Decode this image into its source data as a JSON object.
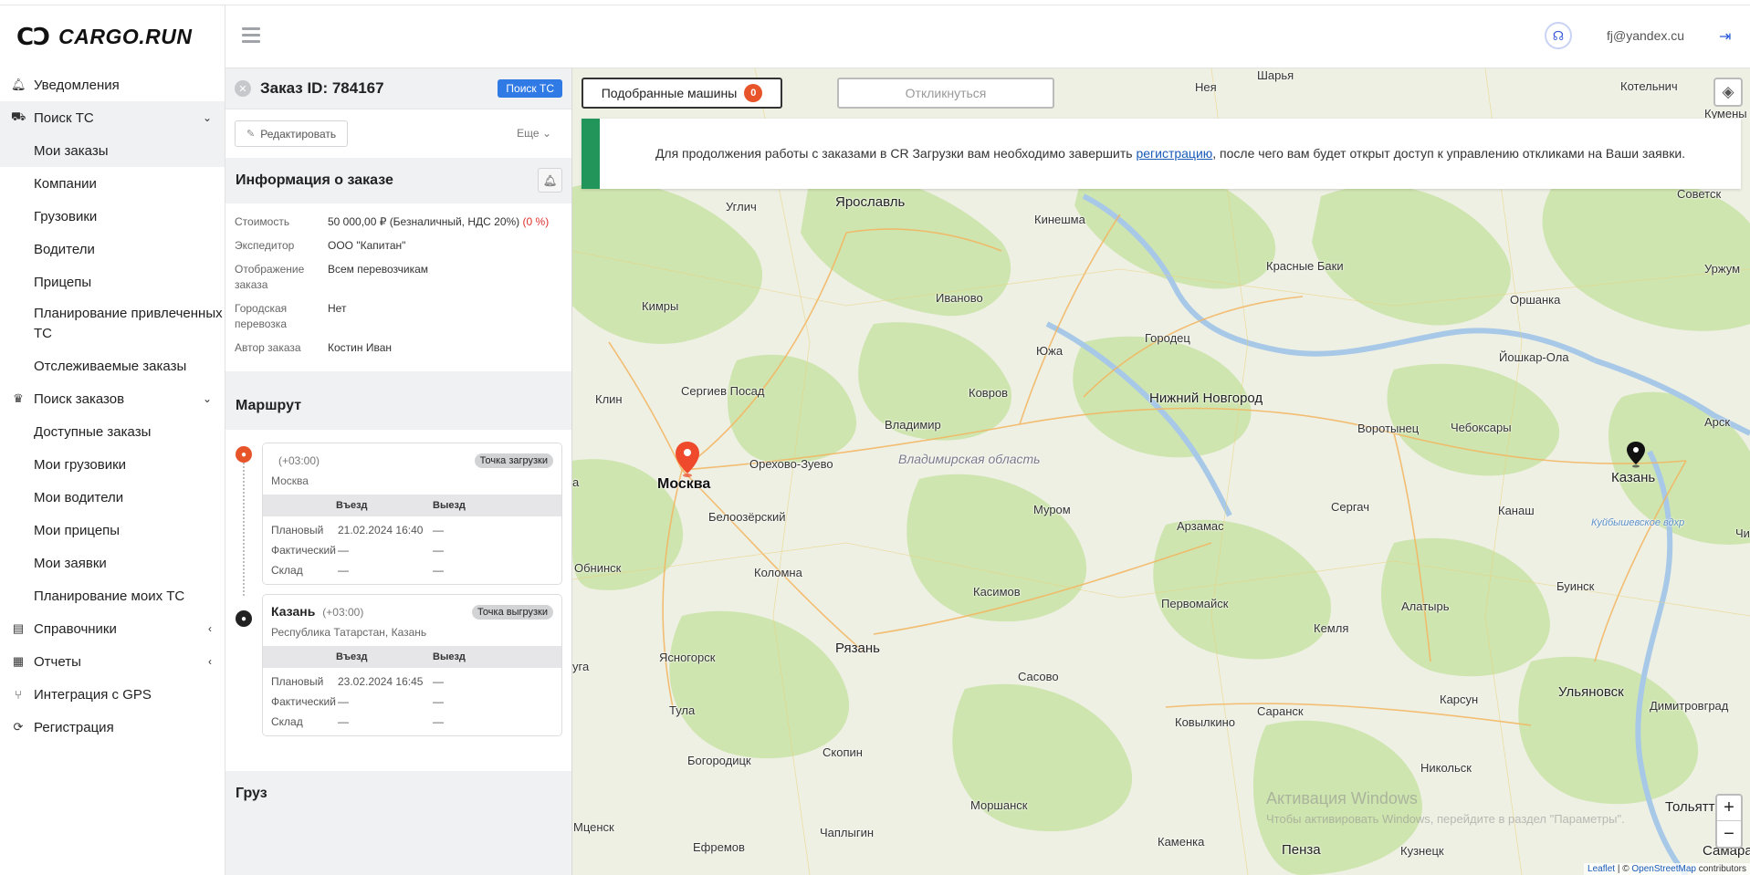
{
  "app": {
    "logo_text": "CARGO.RUN",
    "logo_mark": "CƆ"
  },
  "header": {
    "user_email": "fj@yandex.cu"
  },
  "sidebar": {
    "items": [
      {
        "label": "Уведомления",
        "icon": "bell-icon"
      },
      {
        "label": "Поиск ТС",
        "icon": "truck-icon",
        "expanded": true,
        "children": [
          "Мои заказы",
          "Компании",
          "Грузовики",
          "Водители",
          "Прицепы",
          "Планирование привлеченных ТС",
          "Отслеживаемые заказы"
        ]
      },
      {
        "label": "Поиск заказов",
        "icon": "crown-icon",
        "expanded": true,
        "children": [
          "Доступные заказы",
          "Мои грузовики",
          "Мои водители",
          "Мои прицепы",
          "Мои заявки",
          "Планирование моих ТС"
        ]
      },
      {
        "label": "Справочники",
        "icon": "book-icon"
      },
      {
        "label": "Отчеты",
        "icon": "report-icon"
      },
      {
        "label": "Интеграция с GPS",
        "icon": "gps-icon"
      },
      {
        "label": "Регистрация",
        "icon": "sync-icon"
      }
    ],
    "active_child": "Мои заказы"
  },
  "order": {
    "title": "Заказ ID: 784167",
    "search_button": "Поиск ТС",
    "edit_button": "Редактировать",
    "more_button": "Еще",
    "info_title": "Информация о заказе",
    "info": [
      {
        "key": "Стоимость",
        "value": "50 000,00 ₽ (Безналичный, НДС 20%)",
        "extra": "(0 %)"
      },
      {
        "key": "Экспедитор",
        "value": "ООО \"Капитан\""
      },
      {
        "key": "Отображение заказа",
        "value": "Всем перевозчикам"
      },
      {
        "key": "Городская перевозка",
        "value": "Нет"
      },
      {
        "key": "Автор заказа",
        "value": "Костин Иван"
      }
    ],
    "route_title": "Маршрут",
    "route": [
      {
        "city": "",
        "tz": "(+03:00)",
        "badge": "Точка загрузки",
        "address": "Москва",
        "col_in": "Въезд",
        "col_out": "Выезд",
        "rows": [
          {
            "label": "Плановый",
            "in": "21.02.2024 16:40",
            "out": "—"
          },
          {
            "label": "Фактический",
            "in": "—",
            "out": "—"
          },
          {
            "label": "Склад",
            "in": "—",
            "out": "—"
          }
        ]
      },
      {
        "city": "Казань",
        "tz": "(+03:00)",
        "badge": "Точка выгрузки",
        "address": "Республика Татарстан, Казань",
        "col_in": "Въезд",
        "col_out": "Выезд",
        "rows": [
          {
            "label": "Плановый",
            "in": "23.02.2024 16:45",
            "out": "—"
          },
          {
            "label": "Фактический",
            "in": "—",
            "out": "—"
          },
          {
            "label": "Склад",
            "in": "—",
            "out": "—"
          }
        ]
      }
    ],
    "cargo_title": "Груз"
  },
  "map": {
    "tab_matched": "Подобранные машины",
    "tab_matched_count": "0",
    "tab_respond": "Откликнуться",
    "banner_before": "Для продолжения работы с заказами в CR Загрузки вам необходимо завершить ",
    "banner_link": "регистрацию",
    "banner_after": ", после чего вам будет открыт доступ к управлению откликами на Ваши заявки.",
    "zoom_in": "+",
    "zoom_out": "−",
    "attribution_leaflet": "Leaflet",
    "attribution_sep": " | © ",
    "attribution_osm": "OpenStreetMap",
    "attribution_contrib": " contributors",
    "watermark_title": "Активация Windows",
    "watermark_text": "Чтобы активировать Windows, перейдите в раздел \"Параметры\".",
    "labels": {
      "sharya": "Шарья",
      "neya": "Нея",
      "kotelnich": "Котельнич",
      "kumeny": "Кумены",
      "uglich": "Углич",
      "yaroslavl": "Ярославль",
      "kineshma": "Кинешма",
      "sovetsk": "Советск",
      "krasnye_baki": "Красные Баки",
      "urzhum": "Уржум",
      "kimry": "Кимры",
      "ivanovo": "Иваново",
      "orshanka": "Оршанка",
      "gorodets": "Городец",
      "yuzha": "Южа",
      "yoshkar_ola": "Йошкар-Ола",
      "klin": "Клин",
      "sergiev_posad": "Сергиев Посад",
      "kovrov": "Ковров",
      "nizhny": "Нижний Новгород",
      "vladimir": "Владимир",
      "vorotynets": "Воротынец",
      "cheboksary": "Чебоксары",
      "arsk": "Арск",
      "orekhovo": "Орехово-Зуево",
      "vladimir_obl": "Владимирская область",
      "moscow": "Москва",
      "kazan": "Казань",
      "beloozersky": "Белоозёрский",
      "murom": "Муром",
      "sergach": "Сергач",
      "kanash": "Канаш",
      "arzamas": "Арзамас",
      "kuibyshev": "Куйбышевское вдхр",
      "obninsk": "Обнинск",
      "kolomna": "Коломна",
      "kasimov": "Касимов",
      "pervomaysk": "Первомайск",
      "alatyr": "Алатырь",
      "buinsk": "Буинск",
      "ryazan": "Рязань",
      "kemlya": "Кемля",
      "yasnogorsk": "Ясногорск",
      "sasovo": "Сасово",
      "saransk": "Саранск",
      "karsun": "Карсун",
      "ulyanovsk": "Ульяновск",
      "dimitrovgrad": "Димитровград",
      "tula": "Тула",
      "kovylkino": "Ковылкино",
      "skopin": "Скопин",
      "bogoroditsk": "Богородицк",
      "nikolsk": "Никольск",
      "morshansk": "Моршанск",
      "tolyatti": "Тольятти",
      "mtsensk": "Мценск",
      "chaplygin": "Чаплыгин",
      "efremov": "Ефремов",
      "kamenka": "Каменка",
      "penza": "Пенза",
      "kuznetsk": "Кузнецк",
      "samara": "Самара",
      "uga": "уга",
      "a": "а",
      "chi": "Чи"
    }
  }
}
